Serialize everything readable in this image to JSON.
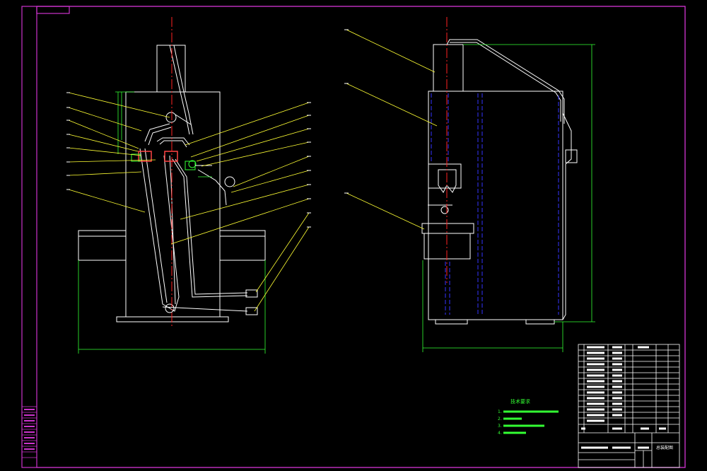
{
  "drawing": {
    "background": "#000000",
    "colors": {
      "frame": "#cc33cc",
      "outline": "#ffffff",
      "center_line": "#ff2222",
      "leader": "#ffff33",
      "dimension": "#33ff33",
      "hidden": "#3333ff",
      "highlight_red": "#ff4444",
      "cyan": "#00ffff"
    },
    "notes": {
      "title": "技术要求",
      "items": [
        "1.",
        "2.",
        "3.",
        "4."
      ]
    },
    "title_block": {
      "drawing_name": "总装配图"
    }
  }
}
